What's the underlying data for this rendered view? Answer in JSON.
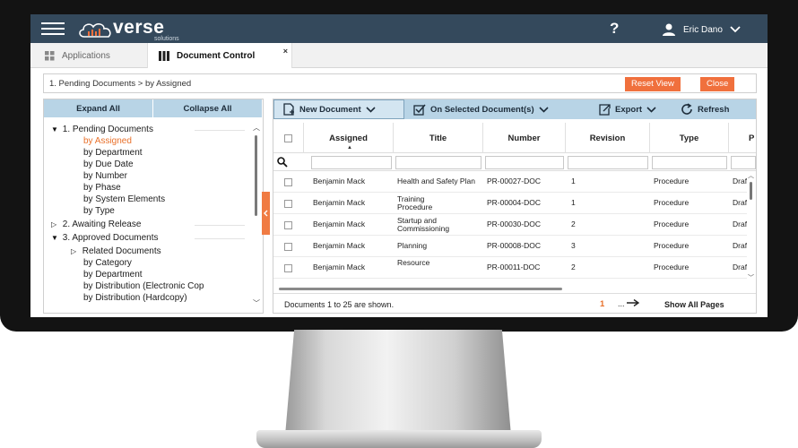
{
  "app": {
    "logo_text": "verse",
    "logo_sub": "solutions",
    "help_label": "?",
    "user_name": "Eric Dano"
  },
  "tabs": [
    {
      "label": "Applications"
    },
    {
      "label": "Document Control",
      "close": "×"
    }
  ],
  "breadcrumb": "1. Pending Documents > by Assigned",
  "actions": {
    "reset": "Reset View",
    "close": "Close"
  },
  "tree": {
    "expand_all": "Expand All",
    "collapse_all": "Collapse All",
    "items": [
      {
        "label": "1. Pending Documents",
        "level": 0,
        "toggle": "▼"
      },
      {
        "label": "by Assigned",
        "level": 1,
        "active": true
      },
      {
        "label": "by Department",
        "level": 1
      },
      {
        "label": "by Due Date",
        "level": 1
      },
      {
        "label": "by Number",
        "level": 1
      },
      {
        "label": "by Phase",
        "level": 1
      },
      {
        "label": "by System Elements",
        "level": 1
      },
      {
        "label": "by Type",
        "level": 1
      },
      {
        "label": "2. Awaiting Release",
        "level": 0,
        "toggle": "▷"
      },
      {
        "label": "3. Approved Documents",
        "level": 0,
        "toggle": "▼"
      },
      {
        "label": "Related Documents",
        "level": 1,
        "toggle": "▷"
      },
      {
        "label": "by Category",
        "level": 1
      },
      {
        "label": "by Department",
        "level": 1
      },
      {
        "label": "by Distribution (Electronic Cop",
        "level": 1
      },
      {
        "label": "by Distribution (Hardcopy)",
        "level": 1
      }
    ]
  },
  "toolbar": {
    "new_document": "New Document",
    "on_selected": "On Selected Document(s)",
    "export": "Export",
    "refresh": "Refresh"
  },
  "grid": {
    "columns": [
      "Assigned",
      "Title",
      "Number",
      "Revision",
      "Type",
      "P"
    ],
    "rows": [
      {
        "assigned": "Benjamin Mack",
        "title": "Health and Safety Plan",
        "number": "PR-00027-DOC",
        "revision": "1",
        "type": "Procedure",
        "p": "Draf"
      },
      {
        "assigned": "Benjamin Mack",
        "title": "Training Procedure",
        "number": "PR-00004-DOC",
        "revision": "1",
        "type": "Procedure",
        "p": "Draf"
      },
      {
        "assigned": "Benjamin Mack",
        "title": "Startup and Commissioning",
        "number": "PR-00030-DOC",
        "revision": "2",
        "type": "Procedure",
        "p": "Draf"
      },
      {
        "assigned": "Benjamin Mack",
        "title": "Planning",
        "number": "PR-00008-DOC",
        "revision": "3",
        "type": "Procedure",
        "p": "Draf"
      },
      {
        "assigned": "Benjamin Mack",
        "title": "Resource",
        "number": "PR-00011-DOC",
        "revision": "2",
        "type": "Procedure",
        "p": "Draf"
      }
    ]
  },
  "footer": {
    "shown_text": "Documents 1 to 25 are shown.",
    "current_page": "1",
    "more": "...",
    "show_all": "Show All Pages"
  },
  "colors": {
    "accent": "#f0703d",
    "header": "#34495c",
    "toolbar": "#b8d4e6"
  }
}
